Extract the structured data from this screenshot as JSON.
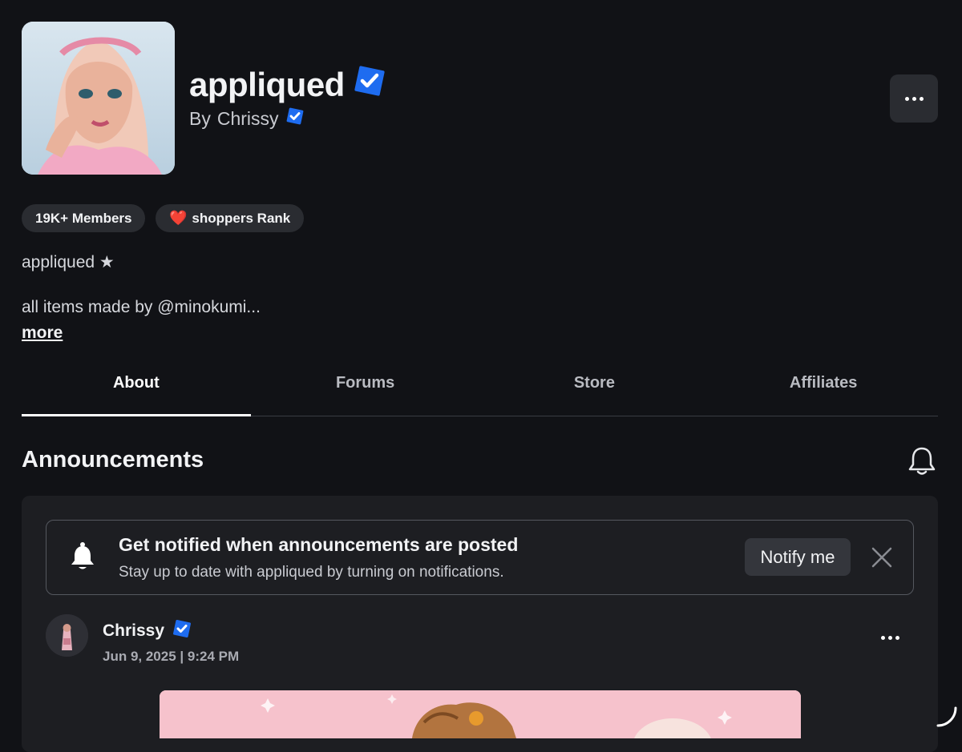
{
  "group": {
    "name": "appliqued",
    "owner_prefix": "By",
    "owner": "Chrissy",
    "verified_color": "#1e6cf0"
  },
  "badges": {
    "members": "19K+ Members",
    "rank_heart": "❤️",
    "rank": "shoppers Rank"
  },
  "description": {
    "line1": "appliqued ★",
    "line2": "all items made by @minokumi...",
    "more_label": "more"
  },
  "tabs": [
    {
      "label": "About"
    },
    {
      "label": "Forums"
    },
    {
      "label": "Store"
    },
    {
      "label": "Affiliates"
    }
  ],
  "announcements": {
    "title": "Announcements",
    "notify_title": "Get notified when announcements are posted",
    "notify_sub": "Stay up to date with appliqued by turning on notifications.",
    "notify_button": "Notify me"
  },
  "post": {
    "author": "Chrissy",
    "date": "Jun 9, 2025 | 9:24 PM"
  },
  "icons": {
    "more": "more-horizontal-icon",
    "bell": "bell-icon",
    "close": "close-icon",
    "verified": "verified-badge-icon"
  }
}
